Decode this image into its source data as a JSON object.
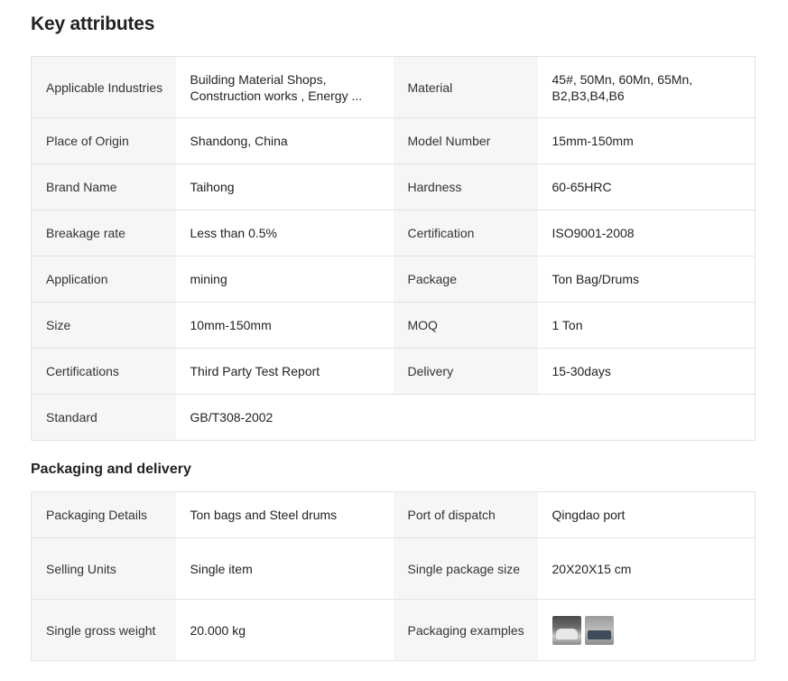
{
  "key_attributes": {
    "title": "Key attributes",
    "rows": [
      [
        {
          "k": "Applicable Industries",
          "v": "Building Material Shops, Construction works , Energy ..."
        },
        {
          "k": "Material",
          "v": "45#, 50Mn, 60Mn, 65Mn, B2,B3,B4,B6"
        }
      ],
      [
        {
          "k": "Place of Origin",
          "v": "Shandong, China"
        },
        {
          "k": "Model Number",
          "v": "15mm-150mm"
        }
      ],
      [
        {
          "k": "Brand Name",
          "v": "Taihong"
        },
        {
          "k": "Hardness",
          "v": "60-65HRC"
        }
      ],
      [
        {
          "k": "Breakage rate",
          "v": "Less than 0.5%"
        },
        {
          "k": "Certification",
          "v": "ISO9001-2008"
        }
      ],
      [
        {
          "k": "Application",
          "v": "mining"
        },
        {
          "k": "Package",
          "v": "Ton Bag/Drums"
        }
      ],
      [
        {
          "k": "Size",
          "v": "10mm-150mm"
        },
        {
          "k": "MOQ",
          "v": "1 Ton"
        }
      ],
      [
        {
          "k": "Certifications",
          "v": "Third Party Test Report"
        },
        {
          "k": "Delivery",
          "v": "15-30days"
        }
      ],
      [
        {
          "k": "Standard",
          "v": "GB/T308-2002"
        }
      ]
    ]
  },
  "packaging": {
    "title": "Packaging and delivery",
    "rows": [
      [
        {
          "k": "Packaging Details",
          "v": "Ton bags and Steel drums"
        },
        {
          "k": "Port of dispatch",
          "v": "Qingdao port"
        }
      ],
      [
        {
          "k": "Selling Units",
          "v": "Single item"
        },
        {
          "k": "Single package size",
          "v": "20X20X15 cm"
        }
      ],
      [
        {
          "k": "Single gross weight",
          "v": "20.000 kg"
        },
        {
          "k": "Packaging examples",
          "images": [
            "packaging-example-photo-1",
            "packaging-example-photo-2"
          ]
        }
      ]
    ]
  }
}
